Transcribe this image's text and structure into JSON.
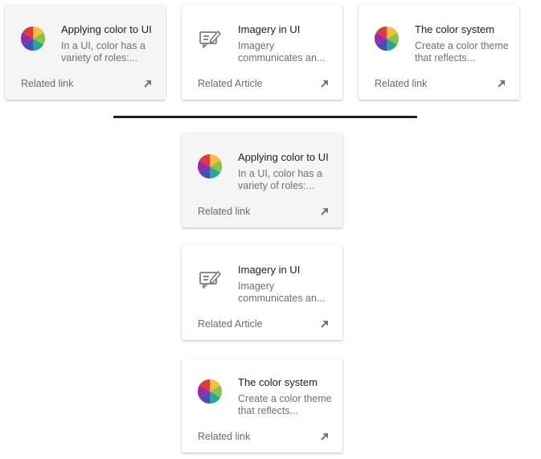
{
  "top_row": [
    {
      "title": "Applying color to UI",
      "description": "In a UI, color has a variety of roles:...",
      "link_label": "Related link",
      "icon": "color-wheel-icon"
    },
    {
      "title": "Imagery in UI",
      "description": "Imagery communicates an...",
      "link_label": "Related Article",
      "icon": "article-edit-icon"
    },
    {
      "title": "The color system",
      "description": "Create a color theme that reflects...",
      "link_label": "Related link",
      "icon": "color-wheel-icon"
    }
  ],
  "stack": [
    {
      "title": "Applying color to UI",
      "description": "In a UI, color has a variety of roles:...",
      "link_label": "Related link",
      "icon": "color-wheel-icon"
    },
    {
      "title": "Imagery in UI",
      "description": "Imagery communicates an...",
      "link_label": "Related Article",
      "icon": "article-edit-icon"
    },
    {
      "title": "The color system",
      "description": "Create a color theme that reflects...",
      "link_label": "Related link",
      "icon": "color-wheel-icon"
    }
  ],
  "colors": {
    "card_background": "#ffffff",
    "hovered_card_background": "#f5f5f5",
    "title_text": "#212121",
    "secondary_text": "#707070",
    "divider": "#1f1f1f"
  }
}
